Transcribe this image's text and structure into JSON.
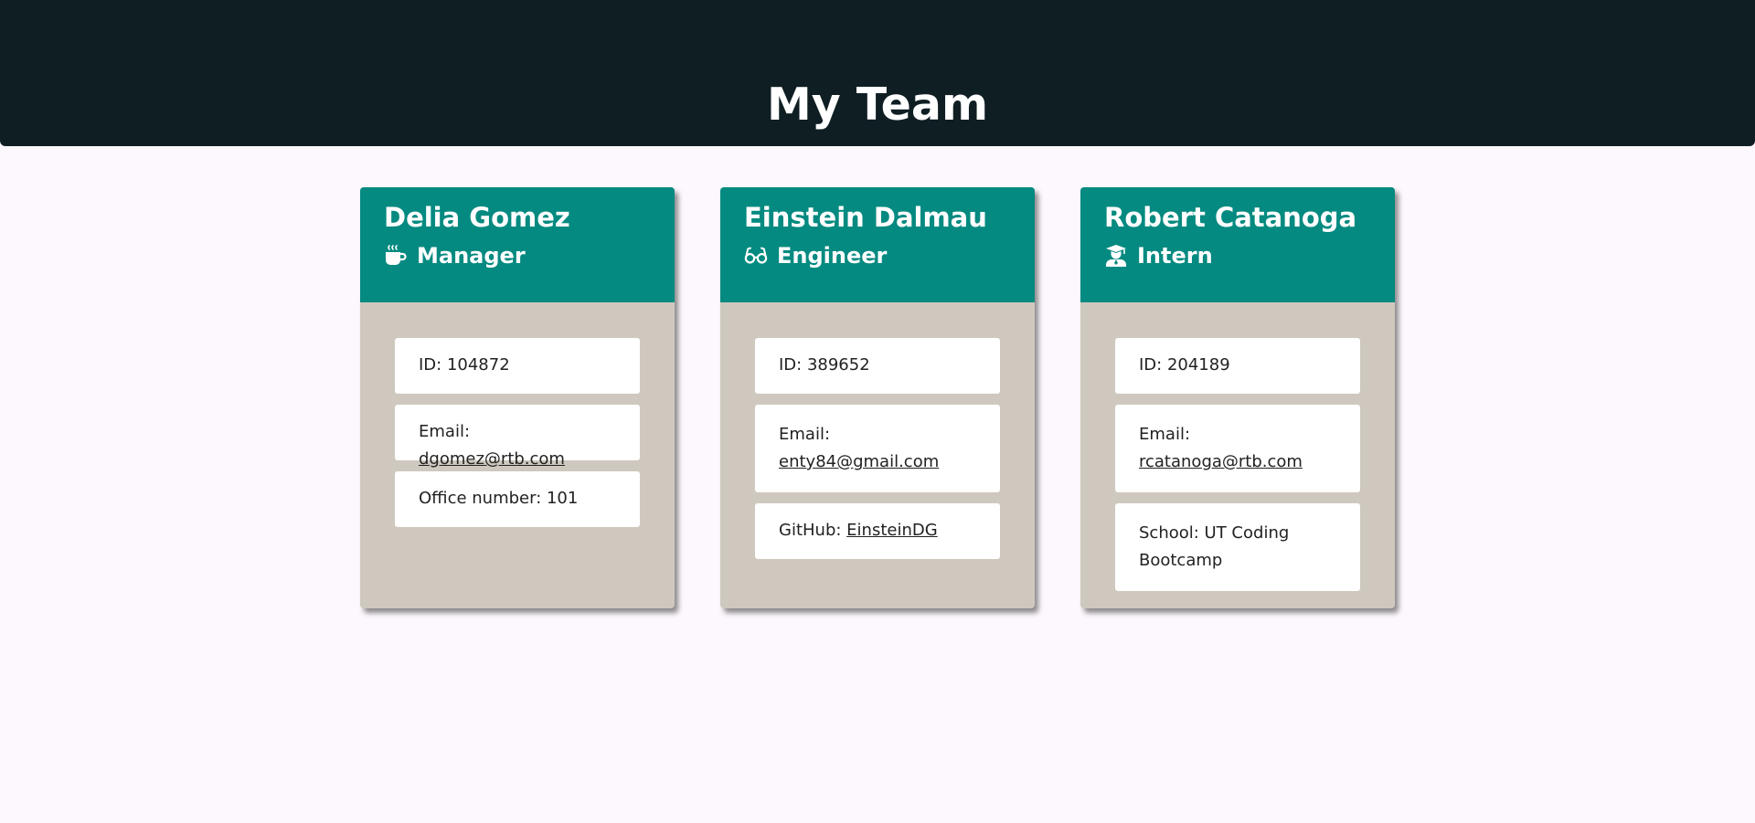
{
  "header": {
    "title": "My Team"
  },
  "team": [
    {
      "name": "Delia Gomez",
      "role": "Manager",
      "icon": "coffee-icon",
      "id_label": "ID: 104872",
      "email_label": "Email: ",
      "email": "dgomez@rtb.com",
      "extra_label": "Office number: 101"
    },
    {
      "name": "Einstein Dalmau",
      "role": "Engineer",
      "icon": "glasses-icon",
      "id_label": "ID: 389652",
      "email_label": "Email:",
      "email": "enty84@gmail.com",
      "extra_label": "GitHub: ",
      "extra_link": "EinsteinDG"
    },
    {
      "name": "Robert Catanoga",
      "role": "Intern",
      "icon": "graduate-icon",
      "id_label": "ID: 204189",
      "email_label": "Email:",
      "email": "rcatanoga@rtb.com",
      "extra_label": "School: UT Coding Bootcamp"
    }
  ],
  "colors": {
    "header_bg": "#0f1e23",
    "card_head_bg": "#048a80",
    "card_body_bg": "#cec8be",
    "page_bg": "#fdf8fd"
  }
}
